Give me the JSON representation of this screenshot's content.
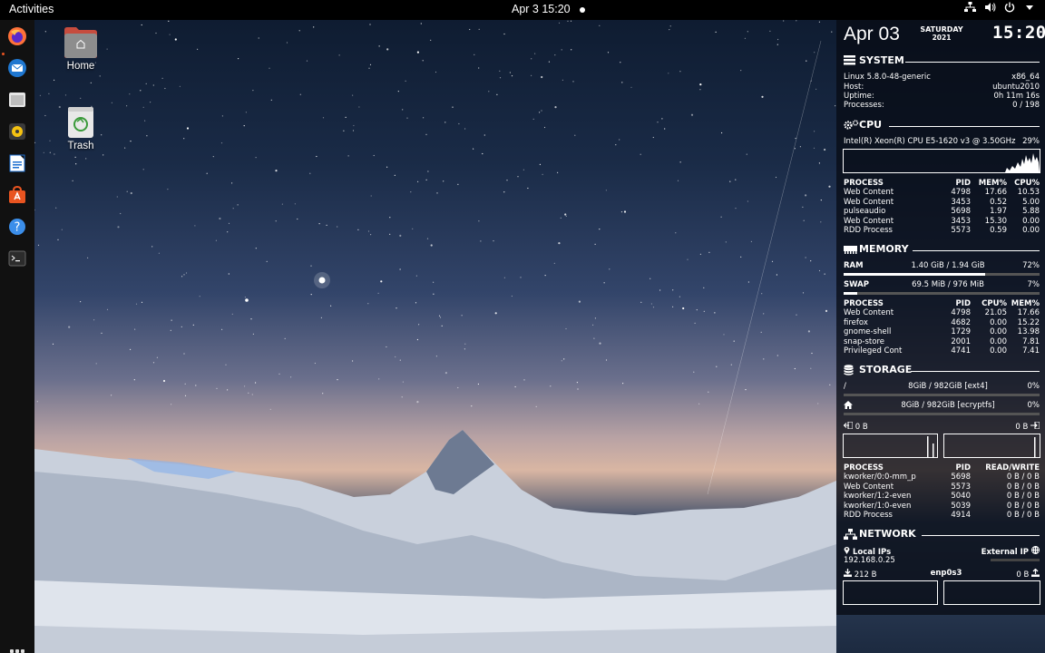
{
  "topbar": {
    "activities": "Activities",
    "datetime": "Apr 3  15:20"
  },
  "desktop": {
    "home_label": "Home",
    "trash_label": "Trash"
  },
  "dock": {
    "apps": [
      "firefox-icon",
      "thunderbird-icon",
      "files-icon",
      "rhythmbox-icon",
      "libreoffice-writer-icon",
      "software-icon",
      "help-icon",
      "terminal-icon"
    ]
  },
  "conky": {
    "date": "Apr 03",
    "weekday": "SATURDAY",
    "year": "2021",
    "time": "15:20",
    "system": {
      "title": "SYSTEM",
      "kernel": "Linux 5.8.0-48-generic",
      "arch": "x86_64",
      "host_label": "Host:",
      "host": "ubuntu2010",
      "uptime_label": "Uptime:",
      "uptime": "0h 11m 16s",
      "processes_label": "Processes:",
      "processes": "0 / 198"
    },
    "cpu": {
      "title": "CPU",
      "model": "Intel(R) Xeon(R) CPU E5-1620 v3 @ 3.50GHz",
      "usage": "29%",
      "headers": [
        "PROCESS",
        "PID",
        "MEM%",
        "CPU%"
      ],
      "rows": [
        [
          "Web Content",
          "4798",
          "17.66",
          "10.53"
        ],
        [
          "Web Content",
          "3453",
          "0.52",
          "5.00"
        ],
        [
          "pulseaudio",
          "5698",
          "1.97",
          "5.88"
        ],
        [
          "Web Content",
          "3453",
          "15.30",
          "0.00"
        ],
        [
          "RDD Process",
          "5573",
          "0.59",
          "0.00"
        ]
      ]
    },
    "memory": {
      "title": "MEMORY",
      "ram_label": "RAM",
      "ram_value": "1.40 GiB / 1.94 GiB",
      "ram_pct": "72%",
      "ram_fraction": 0.72,
      "swap_label": "SWAP",
      "swap_value": "69.5 MiB / 976 MiB",
      "swap_pct": "7%",
      "swap_fraction": 0.07,
      "headers": [
        "PROCESS",
        "PID",
        "CPU%",
        "MEM%"
      ],
      "rows": [
        [
          "Web Content",
          "4798",
          "21.05",
          "17.66"
        ],
        [
          "firefox",
          "4682",
          "0.00",
          "15.22"
        ],
        [
          "gnome-shell",
          "1729",
          "0.00",
          "13.98"
        ],
        [
          "snap-store",
          "2001",
          "0.00",
          "7.81"
        ],
        [
          "Privileged Cont",
          "4741",
          "0.00",
          "7.41"
        ]
      ]
    },
    "storage": {
      "title": "STORAGE",
      "root_label": "/",
      "root_value": "8GiB / 982GiB [ext4]",
      "root_pct": "0%",
      "home_value": "8GiB / 982GiB [ecryptfs]",
      "home_pct": "0%",
      "read_value": "0 B",
      "write_value": "0 B",
      "headers": [
        "PROCESS",
        "PID",
        "READ/WRITE"
      ],
      "rows": [
        [
          "kworker/0:0-mm_p",
          "5698",
          "0 B / 0 B"
        ],
        [
          "Web Content",
          "5573",
          "0 B / 0 B"
        ],
        [
          "kworker/1:2-even",
          "5040",
          "0 B / 0 B"
        ],
        [
          "kworker/1:0-even",
          "5039",
          "0 B / 0 B"
        ],
        [
          "RDD Process",
          "4914",
          "0 B / 0 B"
        ]
      ]
    },
    "network": {
      "title": "NETWORK",
      "local_label": "Local IPs",
      "local_ip": "192.168.0.25",
      "external_label": "External IP",
      "down_value": "212 B",
      "interface": "enp0s3",
      "up_value": "0 B"
    }
  }
}
